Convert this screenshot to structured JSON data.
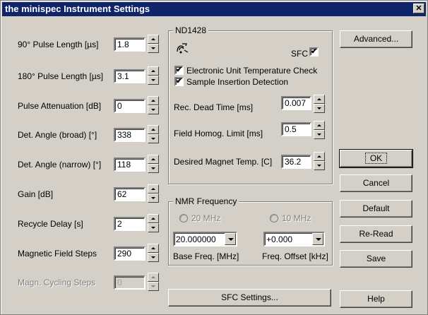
{
  "window": {
    "title": "the minispec Instrument Settings",
    "close_glyph": "✕"
  },
  "left_params": [
    {
      "label": "90° Pulse Length [µs]",
      "value": "1.8",
      "enabled": true
    },
    {
      "label": "180° Pulse Length [µs]",
      "value": "3.1",
      "enabled": true
    },
    {
      "label": "Pulse Attenuation [dB]",
      "value": "0",
      "enabled": true
    },
    {
      "label": "Det. Angle (broad) [°]",
      "value": "338",
      "enabled": true
    },
    {
      "label": "Det. Angle (narrow) [°]",
      "value": "118",
      "enabled": true
    },
    {
      "label": "Gain [dB]",
      "value": "62",
      "enabled": true
    },
    {
      "label": "Recycle Delay [s]",
      "value": "2",
      "enabled": true
    },
    {
      "label": "Magnetic Field Steps",
      "value": "290",
      "enabled": true
    },
    {
      "label": "Magn. Cycling Steps",
      "value": "0",
      "enabled": false
    }
  ],
  "nd_group": {
    "title": "ND1428",
    "sfc_label": "SFC",
    "sfc_checked": true,
    "checks": [
      {
        "label": "Electronic Unit Temperature Check",
        "checked": true
      },
      {
        "label": "Sample Insertion Detection",
        "checked": true
      }
    ],
    "params": [
      {
        "label": "Rec. Dead Time [ms]",
        "value": "0.007"
      },
      {
        "label": "Field Homog. Limit [ms]",
        "value": "0.5"
      },
      {
        "label": "Desired Magnet Temp. [C]",
        "value": "36.2"
      }
    ]
  },
  "nmr_group": {
    "title": "NMR Frequency",
    "radio_20": "20 MHz",
    "radio_10": "10 MHz",
    "base_value": "20.000000",
    "offset_value": "+0.000",
    "base_label": "Base Freq. [MHz]",
    "offset_label": "Freq. Offset [kHz]"
  },
  "buttons": {
    "advanced": "Advanced...",
    "ok": "OK",
    "cancel": "Cancel",
    "default": "Default",
    "reread": "Re-Read",
    "save": "Save",
    "help": "Help",
    "sfc_settings": "SFC Settings..."
  },
  "icons": {
    "title_close": "close-icon",
    "magnet": "magnet-icon"
  }
}
